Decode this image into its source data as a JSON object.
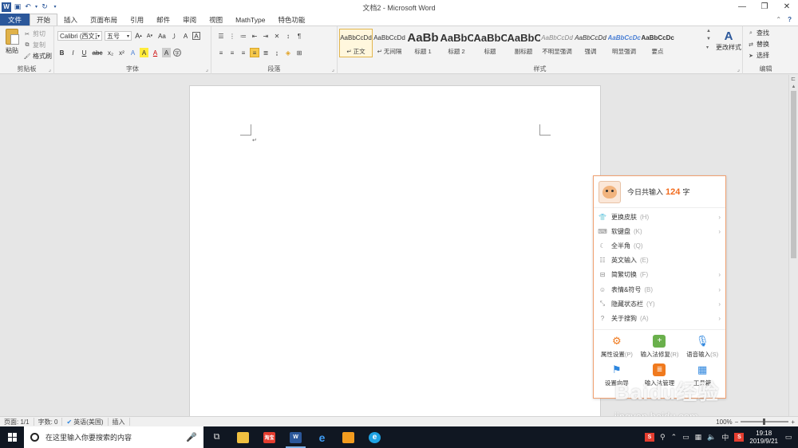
{
  "window": {
    "title": "文档2 - Microsoft Word",
    "app_logo": "W",
    "help": "?",
    "controls": {
      "minimize": "—",
      "maximize": "❐",
      "close": "✕"
    }
  },
  "tabs": [
    {
      "label": "文件"
    },
    {
      "label": "开始"
    },
    {
      "label": "插入"
    },
    {
      "label": "页面布局"
    },
    {
      "label": "引用"
    },
    {
      "label": "邮件"
    },
    {
      "label": "审阅"
    },
    {
      "label": "视图"
    },
    {
      "label": "MathType"
    },
    {
      "label": "特色功能"
    }
  ],
  "ribbon": {
    "clipboard": {
      "label": "剪贴板",
      "paste": "粘贴",
      "cut": "剪切",
      "copy": "复制",
      "format_painter": "格式刷"
    },
    "font": {
      "label": "字体",
      "font_name": "Calibri (西文正",
      "font_size": "五号",
      "bold": "B",
      "italic": "I",
      "underline": "U",
      "strike": "abc",
      "subscript": "x₂",
      "superscript": "x²",
      "grow": "A",
      "shrink": "A",
      "aa": "Aa",
      "clear": "A",
      "highlight": "A",
      "color_a": "A",
      "char_border": "A",
      "char_circle": "字"
    },
    "paragraph": {
      "label": "段落"
    },
    "styles": {
      "label": "样式",
      "items": [
        {
          "sample": "AaBbCcDd",
          "name": "↵ 正文"
        },
        {
          "sample": "AaBbCcDd",
          "name": "↵ 无间隔"
        },
        {
          "sample": "AaBb",
          "name": "标题 1"
        },
        {
          "sample": "AaBbC",
          "name": "标题 2"
        },
        {
          "sample": "AaBbC",
          "name": "标题"
        },
        {
          "sample": "AaBbC",
          "name": "副标题"
        },
        {
          "sample": "AaBbCcDd",
          "name": "不明显强调"
        },
        {
          "sample": "AaBbCcDd",
          "name": "强调"
        },
        {
          "sample": "AaBbCcDc",
          "name": "明显强调"
        },
        {
          "sample": "AaBbCcDc",
          "name": "要点"
        }
      ],
      "change_styles": "更改样式"
    },
    "editing": {
      "label": "编辑",
      "find": "查找",
      "replace": "替换",
      "select": "选择"
    }
  },
  "ime_popup": {
    "count_label_before": "今日共输入",
    "count": "124",
    "count_label_after": "字",
    "menu": [
      {
        "label": "更换皮肤",
        "key": "(H)",
        "submenu": true,
        "icon": "shirt-icon"
      },
      {
        "label": "软键盘",
        "key": "(K)",
        "submenu": true,
        "icon": "keyboard-icon"
      },
      {
        "label": "全半角",
        "key": "(Q)",
        "submenu": false,
        "icon": "moon-icon"
      },
      {
        "label": "英文输入",
        "key": "(E)",
        "submenu": false,
        "icon": "english-icon"
      },
      {
        "label": "简繁切换",
        "key": "(F)",
        "submenu": true,
        "icon": "convert-icon"
      },
      {
        "label": "表情&符号",
        "key": "(B)",
        "submenu": true,
        "icon": "emoji-icon"
      },
      {
        "label": "隐藏状态栏",
        "key": "(Y)",
        "submenu": true,
        "icon": "hide-icon"
      },
      {
        "label": "关于搜狗",
        "key": "(A)",
        "submenu": true,
        "icon": "help-icon"
      }
    ],
    "tiles": [
      {
        "label": "属性设置",
        "key": "(P)",
        "color": "#f07a1e"
      },
      {
        "label": "输入法修复",
        "key": "(R)",
        "color": "#6ab04c"
      },
      {
        "label": "语音输入",
        "key": "(S)",
        "color": "#2e86de"
      },
      {
        "label": "设置向导",
        "key": "",
        "color": "#2e86de"
      },
      {
        "label": "输入法管理",
        "key": "",
        "color": "#f07a1e"
      },
      {
        "label": "工具箱",
        "key": "",
        "color": "#2e86de"
      }
    ]
  },
  "status": {
    "page": "页面: 1/1",
    "words": "字数: 0",
    "language": "英语(美国)",
    "mode": "插入",
    "zoom": "100%"
  },
  "watermark": {
    "main": "Baidu经验",
    "sub": "jingyan.baidu.com"
  },
  "taskbar": {
    "search_placeholder": "在这里输入你要搜索的内容",
    "apps": [
      {
        "name": "task-view",
        "label": ""
      },
      {
        "name": "file-explorer",
        "label": ""
      },
      {
        "name": "taobao",
        "label": "淘宝"
      },
      {
        "name": "word",
        "label": "W"
      },
      {
        "name": "edge",
        "label": "e"
      },
      {
        "name": "app-orange",
        "label": ""
      },
      {
        "name": "ie",
        "label": "e"
      }
    ],
    "ime_indicator": "中",
    "time": "19:18",
    "date": "2019/9/21"
  }
}
